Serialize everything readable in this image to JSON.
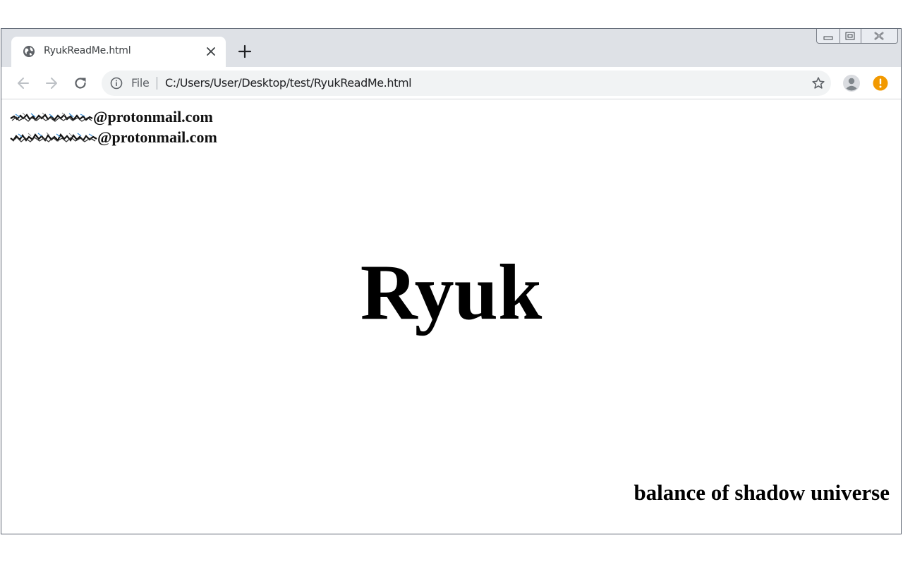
{
  "tab": {
    "title": "RyukReadMe.html",
    "favicon": "globe-icon"
  },
  "window_controls": [
    "minimize-icon",
    "maximize-icon",
    "close-icon"
  ],
  "toolbar": {
    "scheme_label": "File",
    "url": "C:/Users/User/Desktop/test/RyukReadMe.html"
  },
  "page": {
    "emails": [
      {
        "user_redacted": true,
        "domain": "@protonmail.com"
      },
      {
        "user_redacted": true,
        "domain": "@protonmail.com"
      }
    ],
    "heading": "Ryuk",
    "slogan": "balance of shadow universe"
  },
  "colors": {
    "titlebar": "#dee1e6",
    "omnibox": "#f1f3f4",
    "alert_badge": "#f29900",
    "text": "#000000"
  }
}
